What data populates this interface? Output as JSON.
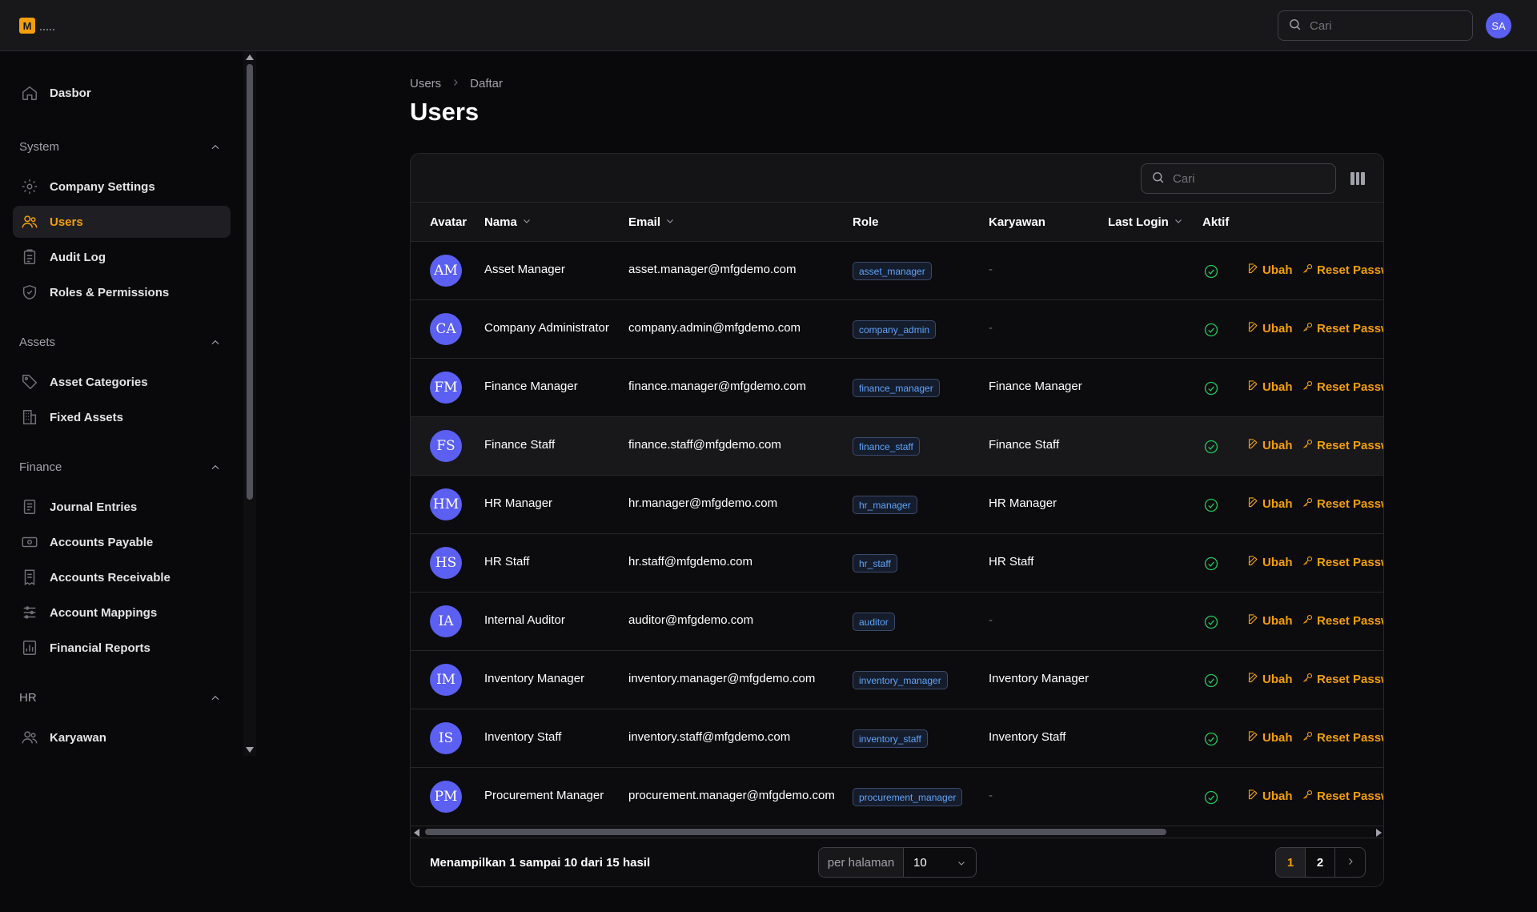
{
  "app": {
    "logo_letter": "M",
    "user_initials": "SA"
  },
  "top_search": {
    "placeholder": "Cari"
  },
  "sidebar": {
    "top_items": [
      {
        "label": "Dasbor",
        "icon": "home-icon"
      }
    ],
    "groups": [
      {
        "label": "System",
        "items": [
          {
            "label": "Company Settings",
            "icon": "gear-icon"
          },
          {
            "label": "Users",
            "icon": "users-icon",
            "active": true
          },
          {
            "label": "Audit Log",
            "icon": "clipboard-icon"
          },
          {
            "label": "Roles & Permissions",
            "icon": "shield-icon"
          }
        ]
      },
      {
        "label": "Assets",
        "items": [
          {
            "label": "Asset Categories",
            "icon": "tag-icon"
          },
          {
            "label": "Fixed Assets",
            "icon": "building-icon"
          }
        ]
      },
      {
        "label": "Finance",
        "items": [
          {
            "label": "Journal Entries",
            "icon": "document-icon"
          },
          {
            "label": "Accounts Payable",
            "icon": "banknote-icon"
          },
          {
            "label": "Accounts Receivable",
            "icon": "receipt-icon"
          },
          {
            "label": "Account Mappings",
            "icon": "sliders-icon"
          },
          {
            "label": "Financial Reports",
            "icon": "chart-icon"
          }
        ]
      },
      {
        "label": "HR",
        "items": [
          {
            "label": "Karyawan",
            "icon": "people-icon"
          }
        ]
      }
    ]
  },
  "breadcrumb": {
    "items": [
      "Users",
      "Daftar"
    ]
  },
  "page_title": "Users",
  "table": {
    "search_placeholder": "Cari",
    "columns": [
      "Avatar",
      "Nama",
      "Email",
      "Role",
      "Karyawan",
      "Last Login",
      "Aktif"
    ],
    "sortable": {
      "Nama": true,
      "Email": true,
      "Last Login": true
    },
    "action_edit": "Ubah",
    "action_reset": "Reset Passw",
    "empty_value": "-",
    "rows": [
      {
        "initials": "AM",
        "name": "Asset Manager",
        "email": "asset.manager@mfgdemo.com",
        "role": "asset_manager",
        "karyawan": "-",
        "last_login": "",
        "active": true
      },
      {
        "initials": "CA",
        "name": "Company Administrator",
        "email": "company.admin@mfgdemo.com",
        "role": "company_admin",
        "karyawan": "-",
        "last_login": "",
        "active": true
      },
      {
        "initials": "FM",
        "name": "Finance Manager",
        "email": "finance.manager@mfgdemo.com",
        "role": "finance_manager",
        "karyawan": "Finance Manager",
        "last_login": "",
        "active": true
      },
      {
        "initials": "FS",
        "name": "Finance Staff",
        "email": "finance.staff@mfgdemo.com",
        "role": "finance_staff",
        "karyawan": "Finance Staff",
        "last_login": "",
        "active": true
      },
      {
        "initials": "HM",
        "name": "HR Manager",
        "email": "hr.manager@mfgdemo.com",
        "role": "hr_manager",
        "karyawan": "HR Manager",
        "last_login": "",
        "active": true
      },
      {
        "initials": "HS",
        "name": "HR Staff",
        "email": "hr.staff@mfgdemo.com",
        "role": "hr_staff",
        "karyawan": "HR Staff",
        "last_login": "",
        "active": true
      },
      {
        "initials": "IA",
        "name": "Internal Auditor",
        "email": "auditor@mfgdemo.com",
        "role": "auditor",
        "karyawan": "-",
        "last_login": "",
        "active": true
      },
      {
        "initials": "IM",
        "name": "Inventory Manager",
        "email": "inventory.manager@mfgdemo.com",
        "role": "inventory_manager",
        "karyawan": "Inventory Manager",
        "last_login": "",
        "active": true
      },
      {
        "initials": "IS",
        "name": "Inventory Staff",
        "email": "inventory.staff@mfgdemo.com",
        "role": "inventory_staff",
        "karyawan": "Inventory Staff",
        "last_login": "",
        "active": true
      },
      {
        "initials": "PM",
        "name": "Procurement Manager",
        "email": "procurement.manager@mfgdemo.com",
        "role": "procurement_manager",
        "karyawan": "-",
        "last_login": "",
        "active": true
      }
    ]
  },
  "footer": {
    "showing": "Menampilkan 1 sampai 10 dari 15 hasil",
    "per_page_label": "per halaman",
    "per_page_value": "10",
    "pages": [
      "1",
      "2"
    ],
    "current_page": "1"
  },
  "colors": {
    "accent": "#f59e0b",
    "avatar": "#5b5ff2",
    "badge_text": "#60a5fa",
    "success": "#22c55e"
  }
}
